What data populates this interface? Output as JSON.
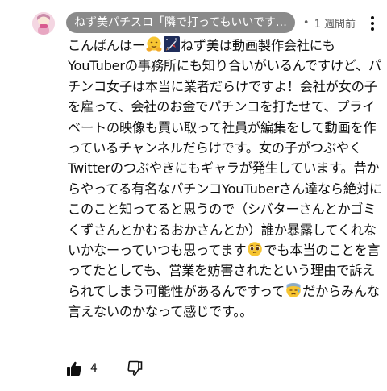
{
  "comment": {
    "author": "ねず美パチスロ「隣で打ってもいいです…",
    "separator": "•",
    "time": "1 週間前",
    "text": {
      "part1": "こんばんはー",
      "part2": "ねず美は動画製作会社にもYouTuberの事務所にも知り合いがいるんですけど、パチンコ女子は本当に業者だらけですよ！会社が女の子を雇って、会社のお金でパチンコを打たせて、プライベートの映像も買い取って社員が編集をして動画を作っているチャンネルだらけです。女の子がつぶやくTwitterのつぶやきにもギャラが発生しています。昔からやってる有名なパチンコYouTuberさん達なら絶対にこのこと知ってると思うので（シバターさんとかゴミくずさんとかむるおかさんとか）誰か暴露してくれないかなーっていつも思ってます",
      "part3": "でも本当のことを言ってたとしても、営業を妨害されたという理由で訴えられてしまう可能性があるんですって",
      "part4": "だからみんな言えないのかなって感じです。。"
    },
    "emojis": [
      "hugging-face",
      "rocket-night-sky",
      "pleading-face",
      "downcast-sweat-face"
    ],
    "likes": "4",
    "icons": {
      "like": "thumbs-up-icon",
      "dislike": "thumbs-down-icon",
      "menu": "more-vertical-icon"
    }
  }
}
